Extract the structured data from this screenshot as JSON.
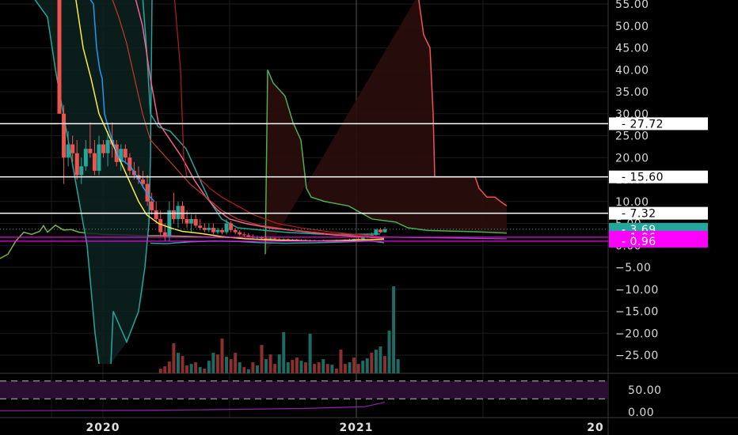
{
  "chart_data": {
    "type": "candlestick",
    "price_axis": {
      "ticks": [
        "55.00",
        "50.00",
        "45.00",
        "40.00",
        "35.00",
        "30.00",
        "25.00",
        "20.00",
        "15.00",
        "10.00",
        "5.00",
        "0.00",
        "-5.00",
        "-10.00",
        "-15.00",
        "-20.00",
        "-25.00"
      ],
      "ylim": [
        -27,
        57
      ]
    },
    "oscillator_axis": {
      "ticks": [
        "50.00",
        "0.00"
      ],
      "ylim": [
        -5,
        80
      ],
      "levels": [
        70,
        30
      ]
    },
    "x_axis": {
      "tick_labels": [
        "2020",
        "2021",
        "20"
      ]
    },
    "horizontal_levels": [
      27.72,
      15.6,
      7.32
    ],
    "price_badges": [
      {
        "label": "27.72",
        "value": 27.72,
        "bg": "#ffffff",
        "fg": "#000000"
      },
      {
        "label": "15.60",
        "value": 15.6,
        "bg": "#ffffff",
        "fg": "#000000"
      },
      {
        "label": "7.32",
        "value": 7.32,
        "bg": "#ffffff",
        "fg": "#000000"
      },
      {
        "label": "3.69",
        "value": 3.69,
        "bg": "#26a69a",
        "fg": "#ffffff"
      },
      {
        "label": "1.86",
        "value": 1.86,
        "bg": "#ff00ff",
        "fg": "#ffffff"
      },
      {
        "label": "0.96",
        "value": 0.96,
        "bg": "#ff00ff",
        "fg": "#ffffff"
      }
    ],
    "candles": [
      {
        "o": 57,
        "h": 57,
        "l": 30,
        "c": 30
      },
      {
        "o": 30,
        "h": 32,
        "l": 14,
        "c": 20
      },
      {
        "o": 20,
        "h": 26,
        "l": 18,
        "c": 23
      },
      {
        "o": 23,
        "h": 25,
        "l": 19,
        "c": 21
      },
      {
        "o": 21,
        "h": 24,
        "l": 15,
        "c": 16
      },
      {
        "o": 16,
        "h": 20,
        "l": 14,
        "c": 18
      },
      {
        "o": 18,
        "h": 24,
        "l": 17,
        "c": 22
      },
      {
        "o": 22,
        "h": 28,
        "l": 20,
        "c": 21
      },
      {
        "o": 21,
        "h": 24,
        "l": 16,
        "c": 17
      },
      {
        "o": 17,
        "h": 25,
        "l": 16,
        "c": 23
      },
      {
        "o": 23,
        "h": 24,
        "l": 20,
        "c": 21
      },
      {
        "o": 21,
        "h": 26,
        "l": 18,
        "c": 24
      },
      {
        "o": 24,
        "h": 28,
        "l": 20,
        "c": 23
      },
      {
        "o": 23,
        "h": 24,
        "l": 18,
        "c": 19
      },
      {
        "o": 19,
        "h": 23,
        "l": 17,
        "c": 22
      },
      {
        "o": 22,
        "h": 23,
        "l": 19,
        "c": 20
      },
      {
        "o": 20,
        "h": 21,
        "l": 16,
        "c": 17
      },
      {
        "o": 17,
        "h": 19,
        "l": 15,
        "c": 16
      },
      {
        "o": 16,
        "h": 18,
        "l": 14,
        "c": 15
      },
      {
        "o": 15,
        "h": 17,
        "l": 13,
        "c": 14
      },
      {
        "o": 14,
        "h": 16,
        "l": 9,
        "c": 10
      },
      {
        "o": 10,
        "h": 12,
        "l": 7,
        "c": 8
      },
      {
        "o": 8,
        "h": 10,
        "l": 5,
        "c": 6
      },
      {
        "o": 6,
        "h": 8,
        "l": 2,
        "c": 3
      },
      {
        "o": 3,
        "h": 5,
        "l": 1,
        "c": 2
      },
      {
        "o": 2,
        "h": 10,
        "l": 1,
        "c": 8
      },
      {
        "o": 8,
        "h": 12,
        "l": 5,
        "c": 6
      },
      {
        "o": 6,
        "h": 10,
        "l": 4,
        "c": 9
      },
      {
        "o": 9,
        "h": 10,
        "l": 5,
        "c": 6
      },
      {
        "o": 6,
        "h": 8,
        "l": 4,
        "c": 5
      },
      {
        "o": 5,
        "h": 7,
        "l": 3,
        "c": 6
      },
      {
        "o": 6,
        "h": 7,
        "l": 4,
        "c": 4.5
      },
      {
        "o": 4.5,
        "h": 6,
        "l": 3.5,
        "c": 4
      },
      {
        "o": 4,
        "h": 5,
        "l": 3,
        "c": 3.5
      },
      {
        "o": 3.5,
        "h": 5,
        "l": 3,
        "c": 4
      },
      {
        "o": 4,
        "h": 5,
        "l": 2.5,
        "c": 3
      },
      {
        "o": 3,
        "h": 4,
        "l": 2.5,
        "c": 3.5
      },
      {
        "o": 3.5,
        "h": 4,
        "l": 2.5,
        "c": 3
      },
      {
        "o": 3,
        "h": 6,
        "l": 2.5,
        "c": 5
      },
      {
        "o": 5,
        "h": 5.5,
        "l": 3,
        "c": 3.5
      },
      {
        "o": 3.5,
        "h": 4,
        "l": 2.5,
        "c": 3
      },
      {
        "o": 3,
        "h": 3.5,
        "l": 2.2,
        "c": 2.5
      },
      {
        "o": 2.5,
        "h": 3,
        "l": 2,
        "c": 2.3
      },
      {
        "o": 2.3,
        "h": 2.8,
        "l": 1.8,
        "c": 2
      },
      {
        "o": 2,
        "h": 2.5,
        "l": 1.6,
        "c": 1.8
      },
      {
        "o": 1.8,
        "h": 2.2,
        "l": 1.5,
        "c": 1.9
      },
      {
        "o": 1.9,
        "h": 2.1,
        "l": 1.4,
        "c": 1.6
      },
      {
        "o": 1.6,
        "h": 2,
        "l": 1.3,
        "c": 1.5
      },
      {
        "o": 1.5,
        "h": 1.9,
        "l": 1.2,
        "c": 1.6
      },
      {
        "o": 1.6,
        "h": 1.8,
        "l": 1.2,
        "c": 1.4
      },
      {
        "o": 1.4,
        "h": 1.7,
        "l": 1.1,
        "c": 1.3
      },
      {
        "o": 1.3,
        "h": 1.6,
        "l": 1.0,
        "c": 1.4
      },
      {
        "o": 1.4,
        "h": 1.6,
        "l": 1.1,
        "c": 1.2
      },
      {
        "o": 1.2,
        "h": 1.5,
        "l": 1.0,
        "c": 1.3
      },
      {
        "o": 1.3,
        "h": 1.5,
        "l": 1.0,
        "c": 1.1
      },
      {
        "o": 1.1,
        "h": 1.4,
        "l": 0.9,
        "c": 1.2
      },
      {
        "o": 1.2,
        "h": 1.4,
        "l": 0.9,
        "c": 1.0
      },
      {
        "o": 1.0,
        "h": 1.3,
        "l": 0.8,
        "c": 1.1
      },
      {
        "o": 1.1,
        "h": 1.3,
        "l": 0.9,
        "c": 1.0
      },
      {
        "o": 1.0,
        "h": 1.2,
        "l": 0.8,
        "c": 1.1
      },
      {
        "o": 1.1,
        "h": 1.3,
        "l": 0.9,
        "c": 1.0
      },
      {
        "o": 1.0,
        "h": 1.2,
        "l": 0.8,
        "c": 0.9
      },
      {
        "o": 0.9,
        "h": 1.2,
        "l": 0.8,
        "c": 1.1
      },
      {
        "o": 1.1,
        "h": 1.3,
        "l": 0.9,
        "c": 1.0
      },
      {
        "o": 1.0,
        "h": 1.2,
        "l": 0.8,
        "c": 1.1
      },
      {
        "o": 1.1,
        "h": 1.4,
        "l": 0.9,
        "c": 1.3
      },
      {
        "o": 1.3,
        "h": 1.5,
        "l": 1.0,
        "c": 1.2
      },
      {
        "o": 1.2,
        "h": 1.6,
        "l": 1.1,
        "c": 1.5
      },
      {
        "o": 1.5,
        "h": 1.8,
        "l": 1.2,
        "c": 1.4
      },
      {
        "o": 1.4,
        "h": 2.0,
        "l": 1.3,
        "c": 1.9
      },
      {
        "o": 1.9,
        "h": 2.5,
        "l": 1.6,
        "c": 2.2
      },
      {
        "o": 2.2,
        "h": 3.0,
        "l": 1.9,
        "c": 2.4
      },
      {
        "o": 2.4,
        "h": 3.8,
        "l": 2.2,
        "c": 3.6
      },
      {
        "o": 3.6,
        "h": 4.0,
        "l": 2.8,
        "c": 3.0
      },
      {
        "o": 3.0,
        "h": 4.2,
        "l": 2.9,
        "c": 3.69
      }
    ],
    "volume": [
      0,
      0,
      0,
      0,
      0,
      0,
      0,
      0,
      0,
      0,
      0,
      0,
      0,
      0,
      0,
      0,
      0,
      0,
      0,
      0,
      0,
      0,
      0,
      6,
      9,
      15,
      38,
      26,
      22,
      10,
      12,
      14,
      8,
      6,
      16,
      26,
      24,
      44,
      21,
      18,
      26,
      14,
      8,
      5,
      14,
      10,
      36,
      18,
      24,
      12,
      24,
      52,
      14,
      17,
      20,
      16,
      14,
      50,
      12,
      14,
      18,
      12,
      11,
      6,
      30,
      12,
      14,
      20,
      12,
      16,
      19,
      26,
      30,
      34,
      22,
      54,
      110,
      18
    ],
    "volume_red": [
      0,
      0,
      0,
      0,
      0,
      0,
      0,
      0,
      0,
      0,
      0,
      0,
      0,
      0,
      0,
      0,
      0,
      0,
      0,
      0,
      0,
      0,
      0,
      1,
      1,
      1,
      1,
      0,
      1,
      1,
      0,
      1,
      0,
      1,
      0,
      0,
      1,
      1,
      0,
      1,
      1,
      0,
      1,
      0,
      1,
      0,
      1,
      0,
      1,
      1,
      0,
      0,
      0,
      1,
      1,
      0,
      1,
      0,
      1,
      1,
      0,
      1,
      0,
      1,
      1,
      1,
      0,
      1,
      1,
      0,
      0,
      1,
      0,
      0,
      1,
      0,
      0,
      0
    ]
  },
  "colors": {
    "up": "#26a69a",
    "down": "#ef5350",
    "grid": "#1b1b1b",
    "axis_text": "#d8d8d8",
    "level_line": "#ffffff",
    "cloud_fill": "#2a0d0c",
    "cloud_edge_a": "#4caf50",
    "cloud_edge_b": "#ef5350",
    "yellow_ma": "#ffeb3b",
    "blue_line": "#2196f3",
    "pink_ma": "#f06292",
    "bb_band": "#26a69a",
    "magenta": "#ff00ff",
    "osc_fill": "#2a0f33",
    "cursor_line": "#555555"
  }
}
